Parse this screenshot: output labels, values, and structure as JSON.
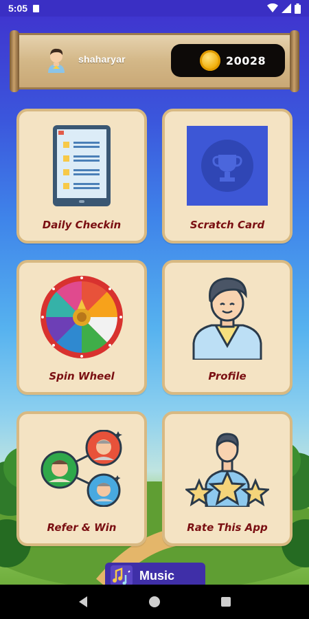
{
  "status_bar": {
    "time": "5:05"
  },
  "header": {
    "username": "shaharyar",
    "coins": "20028"
  },
  "cards": [
    {
      "label": "Daily Checkin",
      "icon": "checklist-icon"
    },
    {
      "label": "Scratch Card",
      "icon": "trophy-scratch-icon"
    },
    {
      "label": "Spin Wheel",
      "icon": "spin-wheel-icon"
    },
    {
      "label": "Profile",
      "icon": "user-profile-icon"
    },
    {
      "label": "Refer & Win",
      "icon": "refer-network-icon"
    },
    {
      "label": "Rate This App",
      "icon": "rate-stars-icon"
    }
  ],
  "music": {
    "label": "Music",
    "icon": "music-notes-icon"
  },
  "colors": {
    "card_bg": "#f4e3c3",
    "card_border": "#d8b982",
    "label": "#7a0f12",
    "coin_pill": "#0d0a08",
    "scratch_blue": "#3d57d6"
  }
}
